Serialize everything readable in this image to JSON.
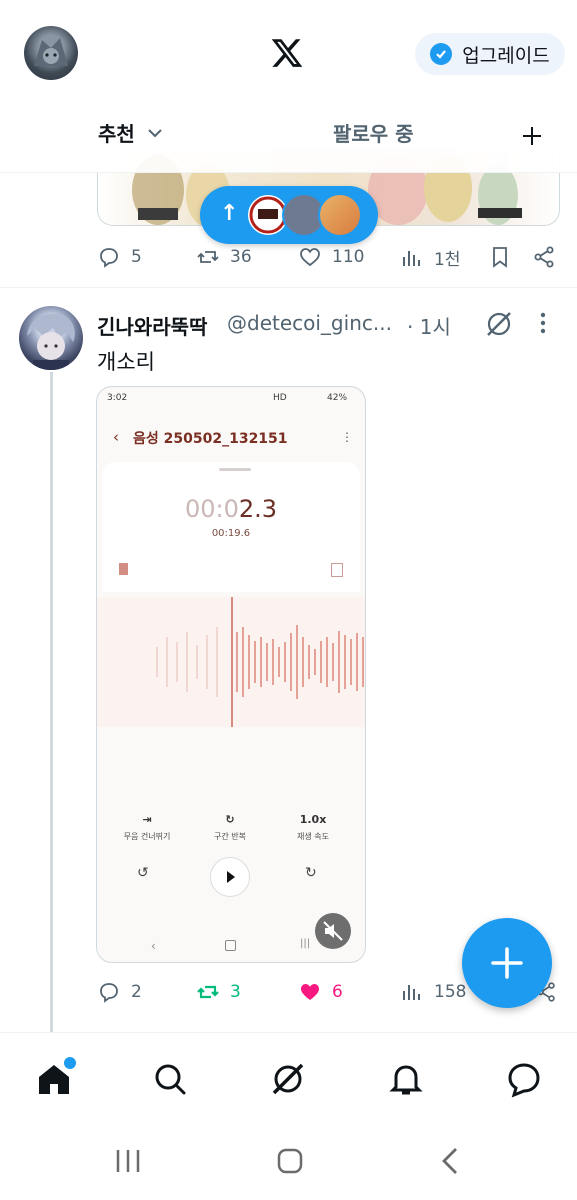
{
  "header": {
    "upgrade_label": "업그레이드",
    "tabs": [
      {
        "label": "추천",
        "active": true
      },
      {
        "label": "팔로우 중",
        "active": false
      }
    ]
  },
  "previous_tweet": {
    "stats": {
      "replies": "5",
      "reposts": "36",
      "likes": "110",
      "views": "1천"
    }
  },
  "tweet": {
    "author_name": "긴나와라뚝딱",
    "handle": "@detecoi_ginc...",
    "time": "· 1시",
    "text": "개소리",
    "stats": {
      "replies": "2",
      "reposts": "3",
      "likes": "6",
      "views": "158"
    },
    "reposted": true,
    "liked": true,
    "media": {
      "status_time": "3:02",
      "status_battery": "42%",
      "status_net": "HD",
      "title": "음성 250502_132151",
      "time_elapsed_dim": "00:0",
      "time_elapsed": "2.3",
      "time_total": "00:19.6",
      "controls": [
        {
          "label": "무음 건너뛰기"
        },
        {
          "label": "구간 반복"
        },
        {
          "value": "1.0x",
          "label": "재생 속도"
        }
      ]
    }
  },
  "colors": {
    "accent": "#1d9bf0",
    "repost": "#00ba7c",
    "like": "#f91880",
    "muted": "#536471"
  }
}
